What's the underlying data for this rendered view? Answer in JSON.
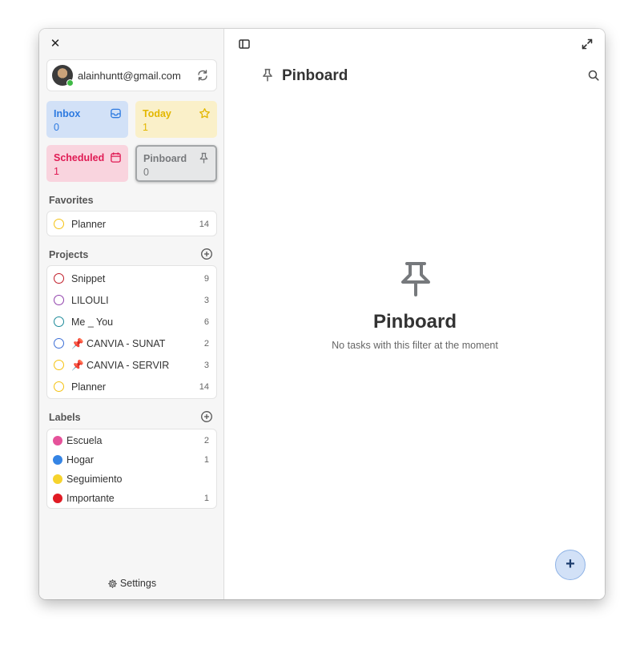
{
  "sidebar": {
    "account": {
      "email": "alainhuntt@gmail.com"
    },
    "filters": {
      "inbox": {
        "label": "Inbox",
        "count": "0"
      },
      "today": {
        "label": "Today",
        "count": "1"
      },
      "scheduled": {
        "label": "Scheduled",
        "count": "1"
      },
      "pinboard": {
        "label": "Pinboard",
        "count": "0"
      }
    },
    "favorites": {
      "title": "Favorites",
      "items": [
        {
          "label": "Planner",
          "count": "14",
          "color": "#f5c211"
        }
      ]
    },
    "projects": {
      "title": "Projects",
      "items": [
        {
          "label": "Snippet",
          "count": "9",
          "color": "#c01c28"
        },
        {
          "label": "LILOULI",
          "count": "3",
          "color": "#9141ac"
        },
        {
          "label": "Me _ You",
          "count": "6",
          "color": "#1c8a99"
        },
        {
          "label": "📌 CANVIA - SUNAT",
          "count": "2",
          "color": "#3d6fd6"
        },
        {
          "label": "📌 CANVIA - SERVIR",
          "count": "3",
          "color": "#f5c211"
        },
        {
          "label": "Planner",
          "count": "14",
          "color": "#f5c211"
        }
      ]
    },
    "labels": {
      "title": "Labels",
      "items": [
        {
          "label": "Escuela",
          "count": "2",
          "color": "#e5529a"
        },
        {
          "label": "Hogar",
          "count": "1",
          "color": "#3584e4"
        },
        {
          "label": "Seguimiento",
          "count": "",
          "color": "#f6d32d"
        },
        {
          "label": "Importante",
          "count": "1",
          "color": "#e01b24"
        }
      ]
    },
    "settings_label": "Settings"
  },
  "main": {
    "title": "Pinboard",
    "empty": {
      "title": "Pinboard",
      "subtitle": "No tasks with this filter at the moment"
    },
    "fab_label": "+"
  },
  "icons": {
    "close": "close-icon",
    "sync": "sync-icon",
    "inbox": "inbox-tray-icon",
    "today": "star-icon",
    "scheduled": "calendar-icon",
    "pinboard": "pin-icon",
    "add": "plus-circle-icon",
    "settings": "gear-icon",
    "sidebar_toggle": "sidebar-toggle-icon",
    "fullscreen": "fullscreen-icon",
    "search": "search-icon"
  }
}
